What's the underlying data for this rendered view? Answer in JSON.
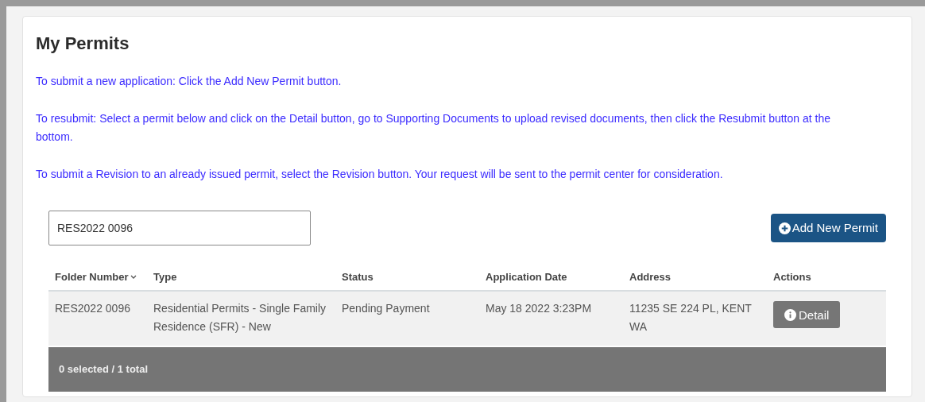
{
  "title": "My Permits",
  "instructions": [
    "To submit a new application: Click the Add New Permit button.",
    "To resubmit: Select a permit below and click on the Detail button, go to Supporting Documents to upload revised documents, then click the Resubmit button at the bottom.",
    "To submit a Revision to an already issued permit, select the Revision button. Your request will be sent to the permit center for consideration."
  ],
  "search": {
    "value": "RES2022 0096"
  },
  "add_button": "Add New Permit",
  "table": {
    "columns": [
      {
        "label": "Folder Number",
        "sorted": true
      },
      {
        "label": "Type",
        "sorted": false
      },
      {
        "label": "Status",
        "sorted": false
      },
      {
        "label": "Application Date",
        "sorted": false
      },
      {
        "label": "Address",
        "sorted": false
      },
      {
        "label": "Actions",
        "sorted": false
      }
    ],
    "rows": [
      {
        "folder_number": "RES2022 0096",
        "type": "Residential Permits - Single Family Residence (SFR) - New",
        "status": "Pending Payment",
        "application_date": "May 18 2022 3:23PM",
        "address": "11235 SE 224 PL, KENT WA",
        "action": "Detail"
      }
    ]
  },
  "footer": "0 selected / 1 total"
}
